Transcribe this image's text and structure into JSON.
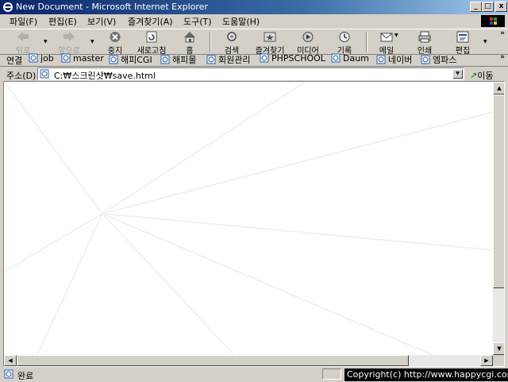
{
  "window": {
    "title": "New Document - Microsoft Internet Explorer",
    "minimize_label": "_",
    "maximize_label": "□",
    "close_label": "x"
  },
  "menu": {
    "items": [
      {
        "label": "파일(F)"
      },
      {
        "label": "편집(E)"
      },
      {
        "label": "보기(V)"
      },
      {
        "label": "즐겨찾기(A)"
      },
      {
        "label": "도구(T)"
      },
      {
        "label": "도움말(H)"
      }
    ]
  },
  "toolbar": {
    "buttons": [
      {
        "label": "뒤로",
        "icon": "back-arrow-icon",
        "disabled": true
      },
      {
        "label": "앞으로",
        "icon": "forward-arrow-icon",
        "disabled": true
      },
      {
        "label": "중지",
        "icon": "stop-icon"
      },
      {
        "label": "새로고침",
        "icon": "refresh-icon"
      },
      {
        "label": "홈",
        "icon": "home-icon"
      },
      {
        "label": "검색",
        "icon": "search-icon"
      },
      {
        "label": "즐겨찾기",
        "icon": "favorites-icon"
      },
      {
        "label": "미디어",
        "icon": "media-icon"
      },
      {
        "label": "기록",
        "icon": "history-icon"
      },
      {
        "label": "메일",
        "icon": "mail-icon"
      },
      {
        "label": "인쇄",
        "icon": "print-icon"
      },
      {
        "label": "편집",
        "icon": "edit-icon"
      }
    ]
  },
  "links": {
    "label": "연결",
    "items": [
      {
        "label": "job"
      },
      {
        "label": "master"
      },
      {
        "label": "해피CGI"
      },
      {
        "label": "해피몰"
      },
      {
        "label": "회원관리"
      },
      {
        "label": "PHPSCHOOL"
      },
      {
        "label": "Daum"
      },
      {
        "label": "네이버"
      },
      {
        "label": "엠파스"
      }
    ],
    "more": "»"
  },
  "address": {
    "label": "주소(D)",
    "value": "C:₩스크린샷₩save.html",
    "go_label": "이동"
  },
  "status": {
    "text": "완료",
    "copyright": "Copyright(c) http://www.happycgi.com"
  },
  "colors": {
    "titlebar_start": "#0a246a",
    "titlebar_end": "#a6caf0",
    "chrome": "#d4d0c8",
    "content_background": "#ffffff",
    "content_rays": "#eeeeee"
  }
}
